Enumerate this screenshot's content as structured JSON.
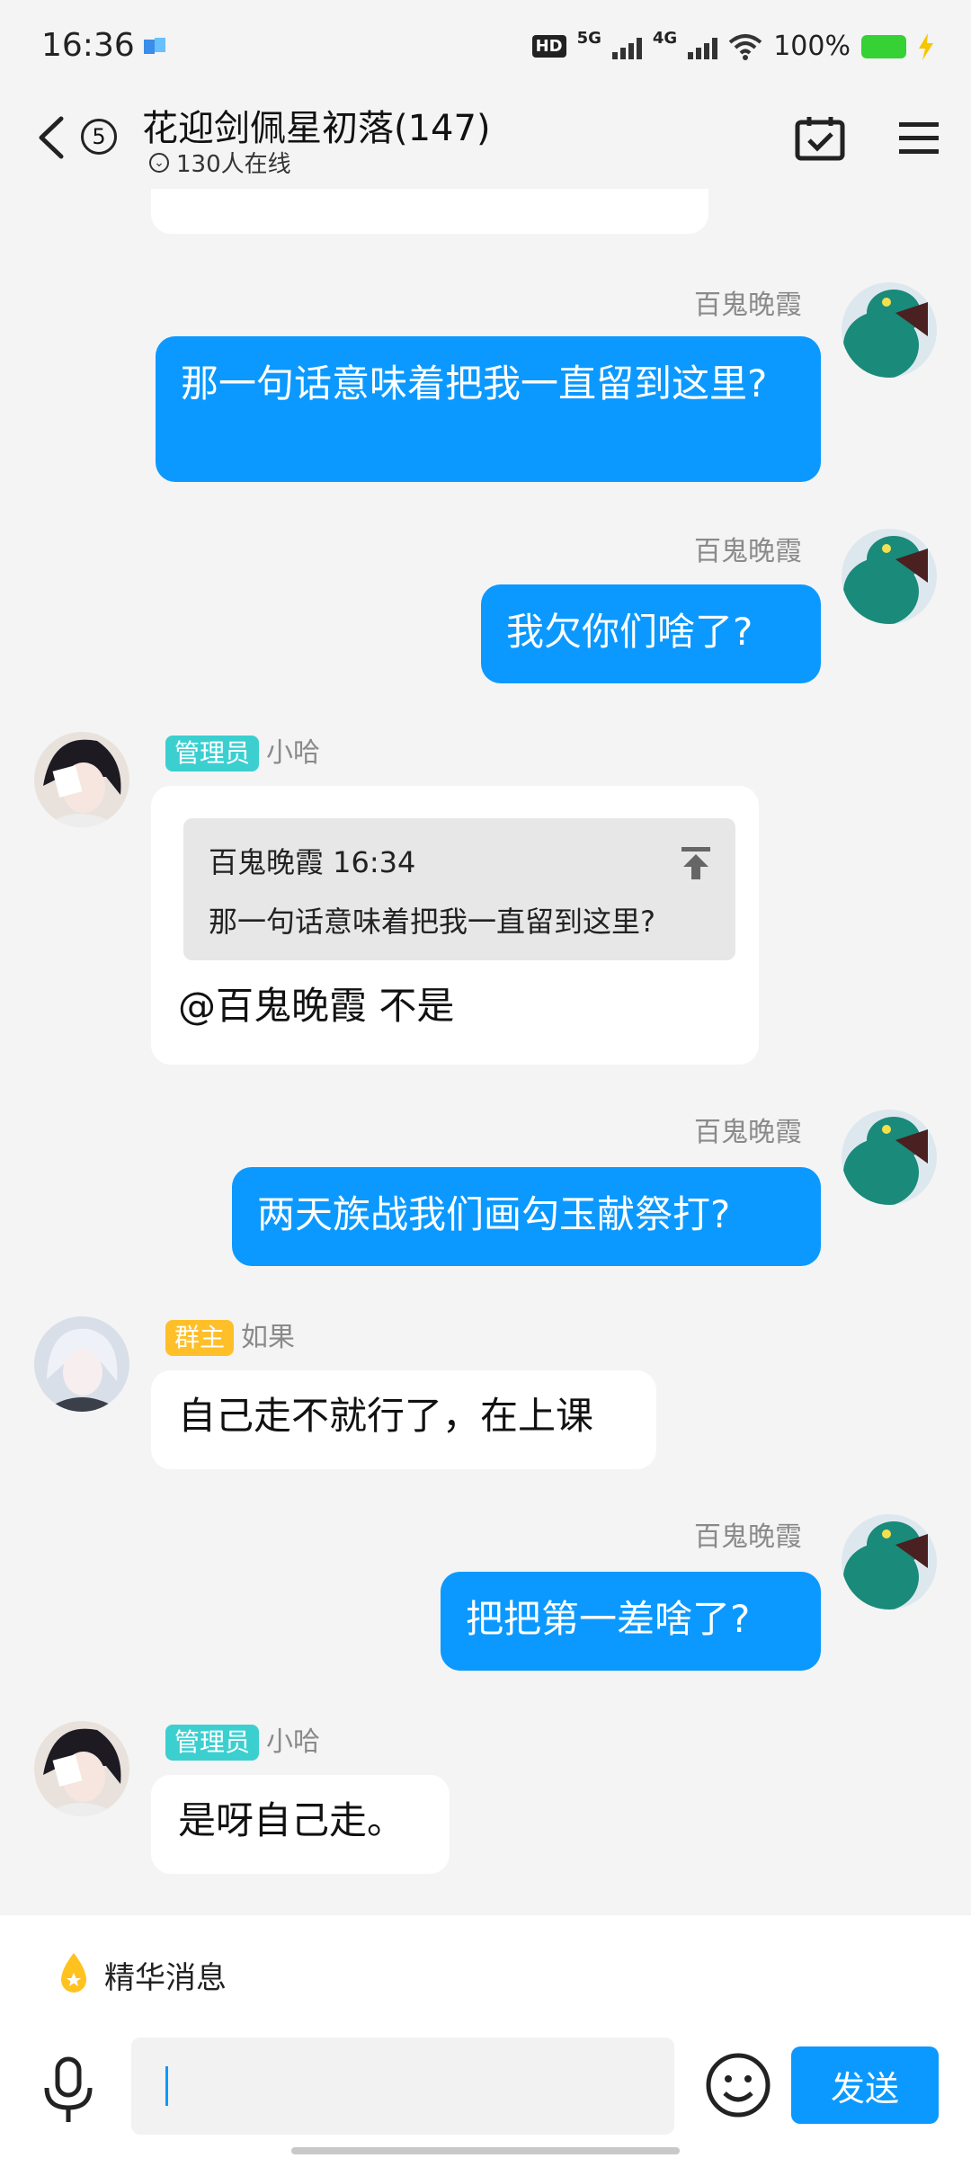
{
  "status_bar": {
    "time": "16:36",
    "hd_label": "HD",
    "net_5g": "5G",
    "net_4g": "4G",
    "battery": "100%"
  },
  "header": {
    "unread_count": "5",
    "title": "花迎剑佩星初落(147)",
    "online": "130人在线"
  },
  "messages": [
    {
      "type": "out",
      "sender": "百鬼晚霞",
      "text": "那一句话意味着把我一直留到这里?"
    },
    {
      "type": "out",
      "sender": "百鬼晚霞",
      "text": "我欠你们啥了?"
    },
    {
      "type": "in",
      "badge": "管理员",
      "sender": "小哈",
      "quote_header": "百鬼晚霞 16:34",
      "quote_text": "那一句话意味着把我一直留到这里?",
      "text": "@百鬼晚霞 不是"
    },
    {
      "type": "out",
      "sender": "百鬼晚霞",
      "text": "两天族战我们画勾玉献祭打?"
    },
    {
      "type": "in",
      "badge": "群主",
      "sender": "如果",
      "text": "自己走不就行了，在上课"
    },
    {
      "type": "out",
      "sender": "百鬼晚霞",
      "text": "把把第一差啥了?"
    },
    {
      "type": "in",
      "badge": "管理员",
      "sender": "小哈",
      "text": "是呀自己走。"
    }
  ],
  "bottom_bar": {
    "essence_label": "精华消息",
    "input_value": "",
    "send_label": "发送"
  },
  "colors": {
    "accent": "#0b99ff",
    "admin_badge": "#3ccfd0",
    "owner_badge": "#ffbf29",
    "background": "#f4f4f4"
  }
}
